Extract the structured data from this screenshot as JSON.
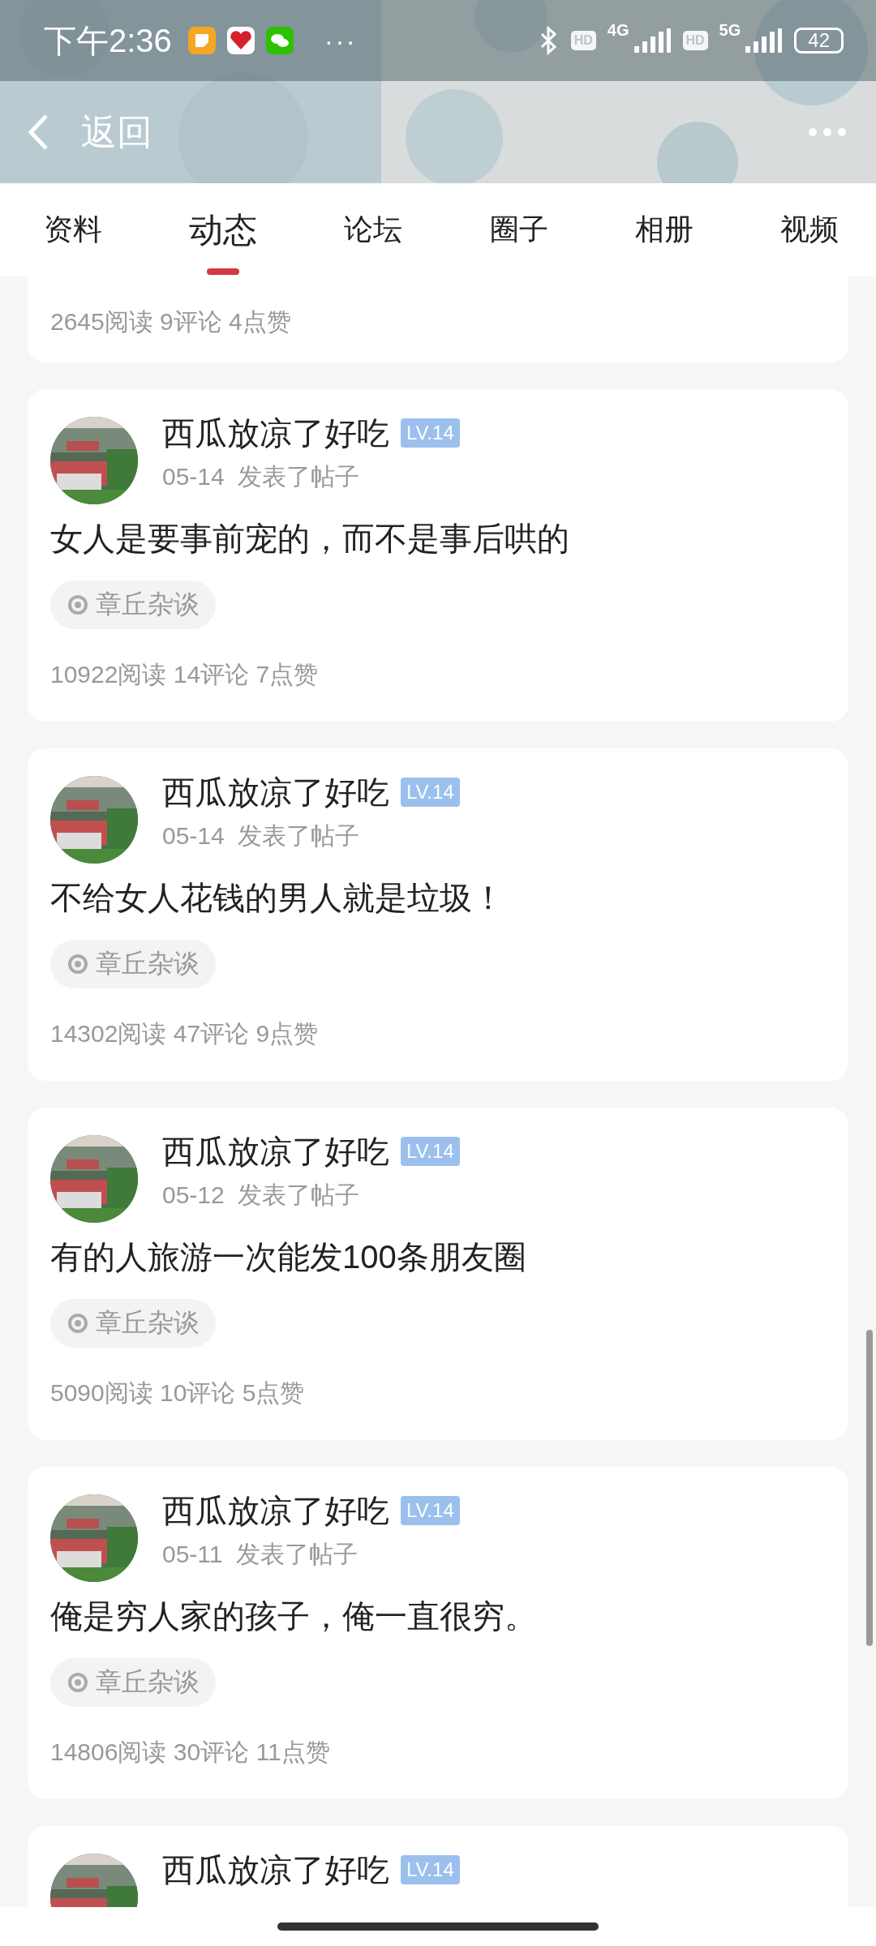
{
  "status_bar": {
    "time": "下午2:36",
    "more": "···",
    "hd_labels": [
      "HD",
      "HD"
    ],
    "networks": [
      "4G",
      "5G"
    ],
    "battery": "42"
  },
  "header": {
    "back_label": "返回"
  },
  "tabs": [
    {
      "label": "资料",
      "selected": false
    },
    {
      "label": "动态",
      "selected": true
    },
    {
      "label": "论坛",
      "selected": false
    },
    {
      "label": "圈子",
      "selected": false
    },
    {
      "label": "相册",
      "selected": false
    },
    {
      "label": "视频",
      "selected": false
    }
  ],
  "partial_post": {
    "stats": "2645阅读 9评论 4点赞"
  },
  "posts": [
    {
      "author": "西瓜放凉了好吃",
      "level": "LV.14",
      "date": "05-14",
      "action": "发表了帖子",
      "text": "女人是要事前宠的，而不是事后哄的",
      "forum": "章丘杂谈",
      "stats": "10922阅读 14评论 7点赞"
    },
    {
      "author": "西瓜放凉了好吃",
      "level": "LV.14",
      "date": "05-14",
      "action": "发表了帖子",
      "text": "不给女人花钱的男人就是垃圾！",
      "forum": "章丘杂谈",
      "stats": "14302阅读 47评论 9点赞"
    },
    {
      "author": "西瓜放凉了好吃",
      "level": "LV.14",
      "date": "05-12",
      "action": "发表了帖子",
      "text": "有的人旅游一次能发100条朋友圈",
      "forum": "章丘杂谈",
      "stats": "5090阅读 10评论 5点赞"
    },
    {
      "author": "西瓜放凉了好吃",
      "level": "LV.14",
      "date": "05-11",
      "action": "发表了帖子",
      "text": "俺是穷人家的孩子，俺一直很穷。",
      "forum": "章丘杂谈",
      "stats": "14806阅读 30评论 11点赞"
    },
    {
      "author": "西瓜放凉了好吃",
      "level": "LV.14"
    }
  ]
}
